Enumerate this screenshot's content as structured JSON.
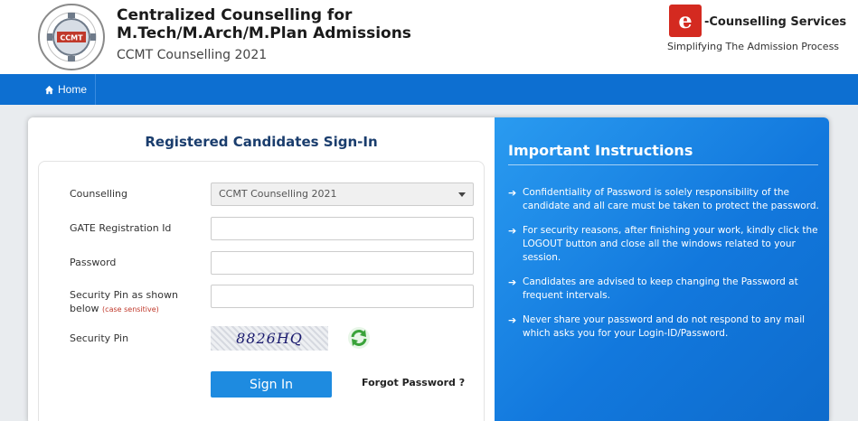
{
  "header": {
    "title_line1": "Centralized Counselling for",
    "title_line2": "M.Tech/M.Arch/M.Plan Admissions",
    "subtitle": "CCMT Counselling 2021",
    "logo_text": "CCMT",
    "logo_ring_text": "Empowering Engineers of Future",
    "ecs_badge": "e",
    "ecs_name": "-Counselling Services",
    "ecs_tagline": "Simplifying The Admission Process"
  },
  "nav": {
    "home_label": "Home"
  },
  "signin": {
    "title": "Registered Candidates Sign-In",
    "labels": {
      "counselling": "Counselling",
      "gate_id": "GATE Registration Id",
      "password": "Password",
      "security_pin_line1": "Security Pin as shown",
      "security_pin_line2": "below",
      "case_sensitive": "(case sensitive)",
      "security_pin": "Security Pin"
    },
    "counselling_selected": "CCMT Counselling 2021",
    "gate_id_value": "",
    "password_value": "",
    "pin_value": "",
    "captcha_text": "8826HQ",
    "signin_button": "Sign In",
    "forgot_password": "Forgot Password ?"
  },
  "instructions": {
    "title": "Important Instructions",
    "items": [
      "Confidentiality of Password is solely responsibility of the candidate and all care must be taken to protect the password.",
      "For security reasons, after finishing your work, kindly click the LOGOUT button and close all the windows related to your session.",
      "Candidates are advised to keep changing the Password at frequent intervals.",
      "Never share your password and do not respond to any mail which asks you for your Login-ID/Password."
    ]
  },
  "colors": {
    "nav_blue": "#0d6fd1",
    "button_blue": "#1e8be0",
    "title_navy": "#1a3d6d",
    "ecs_red": "#d42a20"
  }
}
